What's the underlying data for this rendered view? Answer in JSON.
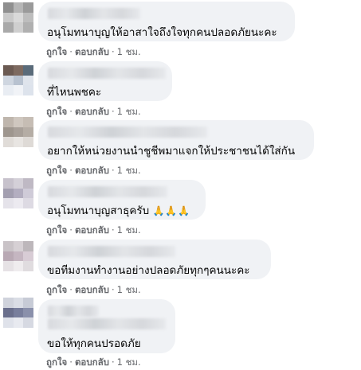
{
  "comments": [
    {
      "text": "อนุโมทนาบุญให้อาสาใจถึงใจทุกคนปลอดภัยนะคะ",
      "like": "ถูกใจ",
      "reply": "ตอบกลับ",
      "time": "1 ชม.",
      "avatar": [
        "#8f8f8f",
        "#b5b5b5",
        "#9a9a9a",
        "#c9c9c9",
        "#d9d9d9",
        "#bdbdbd",
        "#a9a9a9",
        "#cfcfcf",
        "#b0b0b0"
      ]
    },
    {
      "text": "ที่ไหนพชคะ",
      "like": "ถูกใจ",
      "reply": "ตอบกลับ",
      "time": "1 ชม.",
      "avatar": [
        "#6b5a52",
        "#7d6a60",
        "#5a6b7a",
        "#cfd6e0",
        "#b8c2d0",
        "#dfe4ec",
        "#e9edf3",
        "#f1f3f7",
        "#dde3ec"
      ]
    },
    {
      "text": "อยากให้หน่วยงานนำชูชีพมาแจกให้ประชาชนได้ใส่กัน",
      "like": "ถูกใจ",
      "reply": "ตอบกลับ",
      "time": "1 ชม.",
      "avatar": [
        "#bfb6ad",
        "#cfc7bf",
        "#c6bdb4",
        "#9e968e",
        "#a8a099",
        "#b5ada5",
        "#e0dcd8",
        "#e8e5e2",
        "#dedad6"
      ]
    },
    {
      "text": "อนุโมทนาบุญสาธุครับ",
      "emoji": "🙏🙏🙏",
      "like": "ถูกใจ",
      "reply": "ตอบกลับ",
      "time": "1 ชม.",
      "avatar": [
        "#c7c2cc",
        "#d4d0d8",
        "#bfb9c4",
        "#a39fb0",
        "#b3aec0",
        "#cfcbd8",
        "#e5e3ea",
        "#eceaf0",
        "#dddae3"
      ]
    },
    {
      "text": "ขอทีมงานทำงานอย่างปลอดภัยทุกๆคนนะคะ",
      "like": "ถูกใจ",
      "reply": "ตอบกลับ",
      "time": "1 ชม.",
      "avatar": [
        "#c9c3c7",
        "#d6d0d4",
        "#bdb7bb",
        "#b9a9b4",
        "#c5b6c1",
        "#d8ccd5",
        "#e6e2e5",
        "#efecee",
        "#e0dcdf"
      ]
    },
    {
      "text": "ขอให้ทุกคนปรอดภัย",
      "like": "ถูกใจ",
      "reply": "ตอบกลับ",
      "time": "1 ชม.",
      "avatar": [
        "#d0d3dc",
        "#dadde5",
        "#c7cbd6",
        "#6a6f8c",
        "#787e9c",
        "#8a90ab",
        "#dfe2ea",
        "#e8eaf0",
        "#d6d9e2"
      ]
    }
  ]
}
